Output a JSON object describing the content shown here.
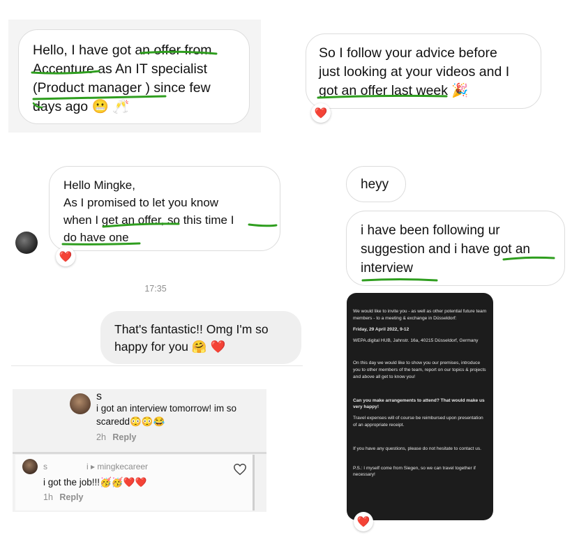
{
  "top_left": {
    "lines": [
      "Hello, I have got an offer from",
      "Accenture as An IT specialist",
      "(Product manager ) since few",
      "days ago 😬 🥂"
    ]
  },
  "top_right": {
    "lines": [
      "So I follow your advice before",
      "just looking at your videos and I",
      "got an offer last week 🎉"
    ],
    "reaction": "❤️"
  },
  "mid_left": {
    "lines": [
      "Hello Mingke,",
      "As I promised to let you know",
      "when I get an offer, so this time I",
      "do have one"
    ],
    "reaction": "❤️",
    "timestamp": "17:35",
    "reply_lines": [
      "That's fantastic!! Omg I'm so",
      "happy for you 🤗 ❤️"
    ]
  },
  "mid_right": {
    "short_message": "heyy",
    "lines": [
      "i have been following ur",
      "suggestion and i have got an",
      "interview"
    ]
  },
  "invite": {
    "p1": "We would like to invite you - as well as other potential future team members - to a meeting & exchange in Düsseldorf:",
    "date": "Friday, 29 April 2022, 9-12",
    "address": "WEPA.digital HUB, Jahnstr. 16a, 40215 Düsseldorf, Germany",
    "p2": "On this day we would like to show you our premises, introduce you to other members of the team, report on our topics & projects and above all get to know you!",
    "question": "Can you make arrangements to attend? That would make us very happy!",
    "p3": "Travel expenses will of course be reimbursed upon presentation of an appropriate receipt.",
    "p4": "If you have any questions, please do not hesitate to contact us.",
    "ps": "P.S.: I myself come from Siegen, so we can travel together if necessary!",
    "reaction": "❤️"
  },
  "comments": {
    "c1": {
      "name": "s",
      "line1": "i got an interview tomorrow! im so",
      "line2": "scaredd😳😳😂",
      "time": "2h",
      "reply": "Reply"
    },
    "c2": {
      "name": "s",
      "reply_marker": "i ▸ mingkecareer",
      "text": "i got the job!!!🥳🥳❤️❤️",
      "time": "1h",
      "reply": "Reply",
      "like_icon": "heart-outline-icon"
    }
  },
  "colors": {
    "highlight": "#2f9e1f",
    "bubble_gray": "#efefef",
    "phone_bg": "#1c1c1c",
    "heart": "#e0245e"
  }
}
